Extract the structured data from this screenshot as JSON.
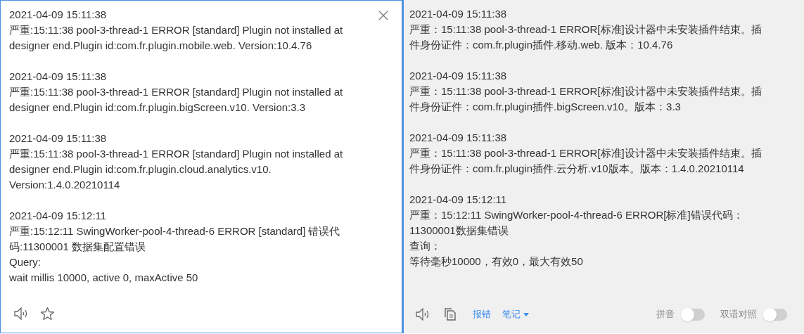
{
  "source": {
    "entries": [
      {
        "timestamp": "2021-04-09 15:11:38",
        "lines": [
          "严重:15:11:38 pool-3-thread-1 ERROR [standard] Plugin not installed at",
          "designer end.Plugin id:com.fr.plugin.mobile.web. Version:10.4.76"
        ]
      },
      {
        "timestamp": "2021-04-09 15:11:38",
        "lines": [
          "严重:15:11:38 pool-3-thread-1 ERROR [standard] Plugin not installed at",
          "designer end.Plugin id:com.fr.plugin.bigScreen.v10. Version:3.3"
        ]
      },
      {
        "timestamp": "2021-04-09 15:11:38",
        "lines": [
          "严重:15:11:38 pool-3-thread-1 ERROR [standard] Plugin not installed at",
          "designer end.Plugin id:com.fr.plugin.cloud.analytics.v10.",
          "Version:1.4.0.20210114"
        ]
      },
      {
        "timestamp": "2021-04-09 15:12:11",
        "lines": [
          "严重:15:12:11 SwingWorker-pool-4-thread-6 ERROR [standard] 错误代",
          "码:11300001 数据集配置错误",
          "Query:",
          "wait millis 10000, active 0, maxActive 50"
        ]
      }
    ]
  },
  "target": {
    "entries": [
      {
        "timestamp": "2021-04-09 15:11:38",
        "lines": [
          "严重：15:11:38 pool-3-thread-1 ERROR[标准]设计器中未安装插件结束。插",
          "件身份证件：com.fr.plugin插件.移动.web. 版本：10.4.76"
        ]
      },
      {
        "timestamp": "2021-04-09 15:11:38",
        "lines": [
          "严重：15:11:38 pool-3-thread-1 ERROR[标准]设计器中未安装插件结束。插",
          "件身份证件：com.fr.plugin插件.bigScreen.v10。版本：3.3"
        ]
      },
      {
        "timestamp": "2021-04-09 15:11:38",
        "lines": [
          "严重：15:11:38 pool-3-thread-1 ERROR[标准]设计器中未安装插件结束。插",
          "件身份证件：com.fr.plugin插件.云分析.v10版本。版本：1.4.0.20210114"
        ]
      },
      {
        "timestamp": "2021-04-09 15:12:11",
        "lines": [
          "严重：15:12:11 SwingWorker-pool-4-thread-6 ERROR[标准]错误代码：",
          "11300001数据集错误",
          "查询：",
          "等待毫秒10000，有效0，最大有效50"
        ]
      }
    ],
    "links": [
      {
        "label": "报错",
        "dropdown": false
      },
      {
        "label": "笔记",
        "dropdown": true
      }
    ],
    "toggles": [
      {
        "label": "拼音",
        "on": false
      },
      {
        "label": "双语对照",
        "on": false
      }
    ]
  }
}
